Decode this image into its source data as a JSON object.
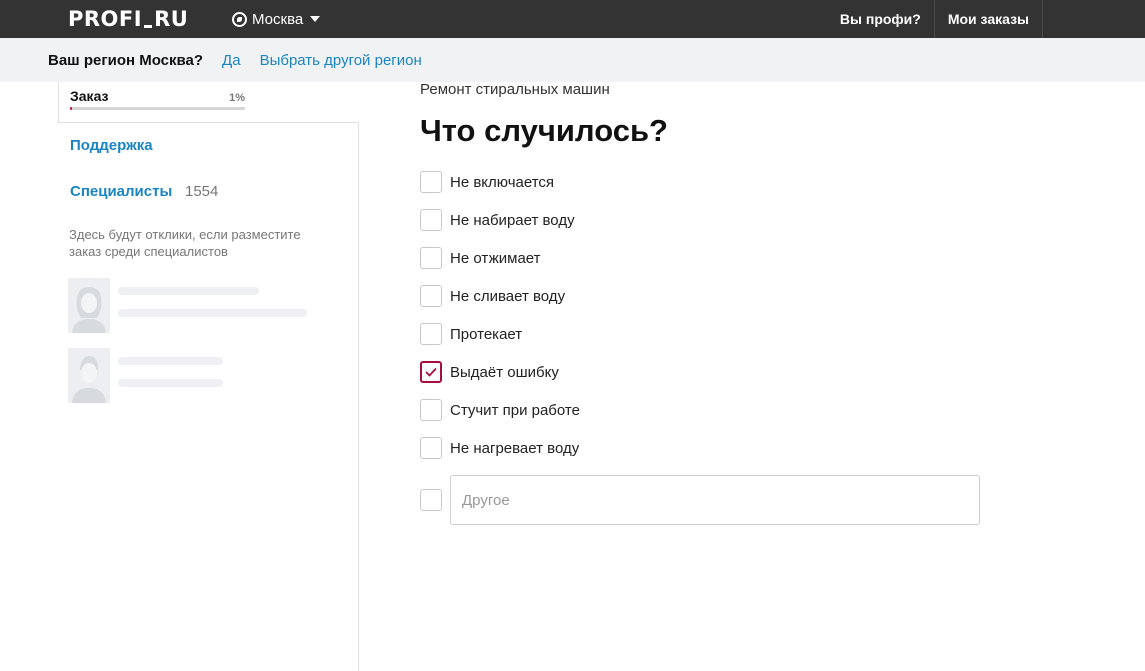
{
  "header": {
    "logo_left": "PROFI",
    "logo_right": "RU",
    "city": "Москва",
    "nav": [
      {
        "label": "Вы профи?"
      },
      {
        "label": "Мои заказы"
      }
    ]
  },
  "region_bar": {
    "question": "Ваш регион Москва?",
    "yes": "Да",
    "choose_other": "Выбрать другой регион"
  },
  "sidebar": {
    "order_label": "Заказ",
    "order_percent": "1%",
    "order_progress": 0.01,
    "support_label": "Поддержка",
    "specialists_label": "Специалисты",
    "specialists_count": "1554",
    "hint": "Здесь будут отклики, если разместите заказ среди специалистов"
  },
  "main": {
    "service": "Ремонт стиральных машин",
    "title": "Что случилось?",
    "options": [
      {
        "label": "Не включается",
        "checked": false
      },
      {
        "label": "Не набирает воду",
        "checked": false
      },
      {
        "label": "Не отжимает",
        "checked": false
      },
      {
        "label": "Не сливает воду",
        "checked": false
      },
      {
        "label": "Протекает",
        "checked": false
      },
      {
        "label": "Выдаёт ошибку",
        "checked": true
      },
      {
        "label": "Стучит при работе",
        "checked": false
      },
      {
        "label": "Не нагревает воду",
        "checked": false
      }
    ],
    "other_placeholder": "Другое",
    "other_value": ""
  },
  "colors": {
    "topbar": "#333333",
    "link": "#1a85c2",
    "accent": "#a50e3b"
  }
}
